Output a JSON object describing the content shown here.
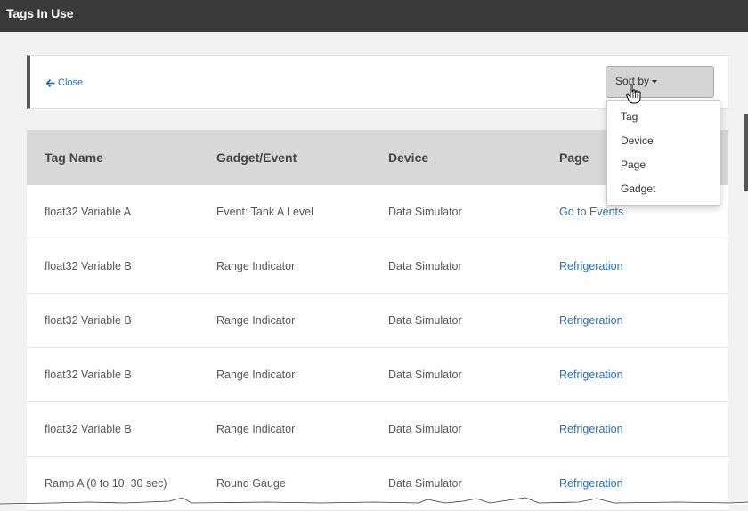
{
  "window": {
    "title": "Tags In Use"
  },
  "toolbar": {
    "close_label": "Close",
    "sort_label": "Sort by"
  },
  "sort_menu": {
    "options": [
      "Tag",
      "Device",
      "Page",
      "Gadget"
    ]
  },
  "table": {
    "columns": [
      "Tag Name",
      "Gadget/Event",
      "Device",
      "Page"
    ],
    "rows": [
      {
        "tag": "float32 Variable A",
        "gadget": "Event: Tank A Level",
        "device": "Data Simulator",
        "page": "Go to Events"
      },
      {
        "tag": "float32 Variable B",
        "gadget": "Range Indicator",
        "device": "Data Simulator",
        "page": "Refrigeration"
      },
      {
        "tag": "float32 Variable B",
        "gadget": "Range Indicator",
        "device": "Data Simulator",
        "page": "Refrigeration"
      },
      {
        "tag": "float32 Variable B",
        "gadget": "Range Indicator",
        "device": "Data Simulator",
        "page": "Refrigeration"
      },
      {
        "tag": "float32 Variable B",
        "gadget": "Range Indicator",
        "device": "Data Simulator",
        "page": "Refrigeration"
      },
      {
        "tag": "Ramp A (0 to 10, 30 sec)",
        "gadget": "Round Gauge",
        "device": "Data Simulator",
        "page": "Refrigeration"
      }
    ]
  },
  "colors": {
    "titlebar": "#3a3a3a",
    "link": "#2a6fb5",
    "header_bg": "#d8d8d8",
    "page_bg": "#f2f2f2"
  },
  "icons": {
    "close": "arrow-left-icon",
    "sort_caret": "caret-down-icon",
    "cursor": "hand-pointer-icon"
  }
}
